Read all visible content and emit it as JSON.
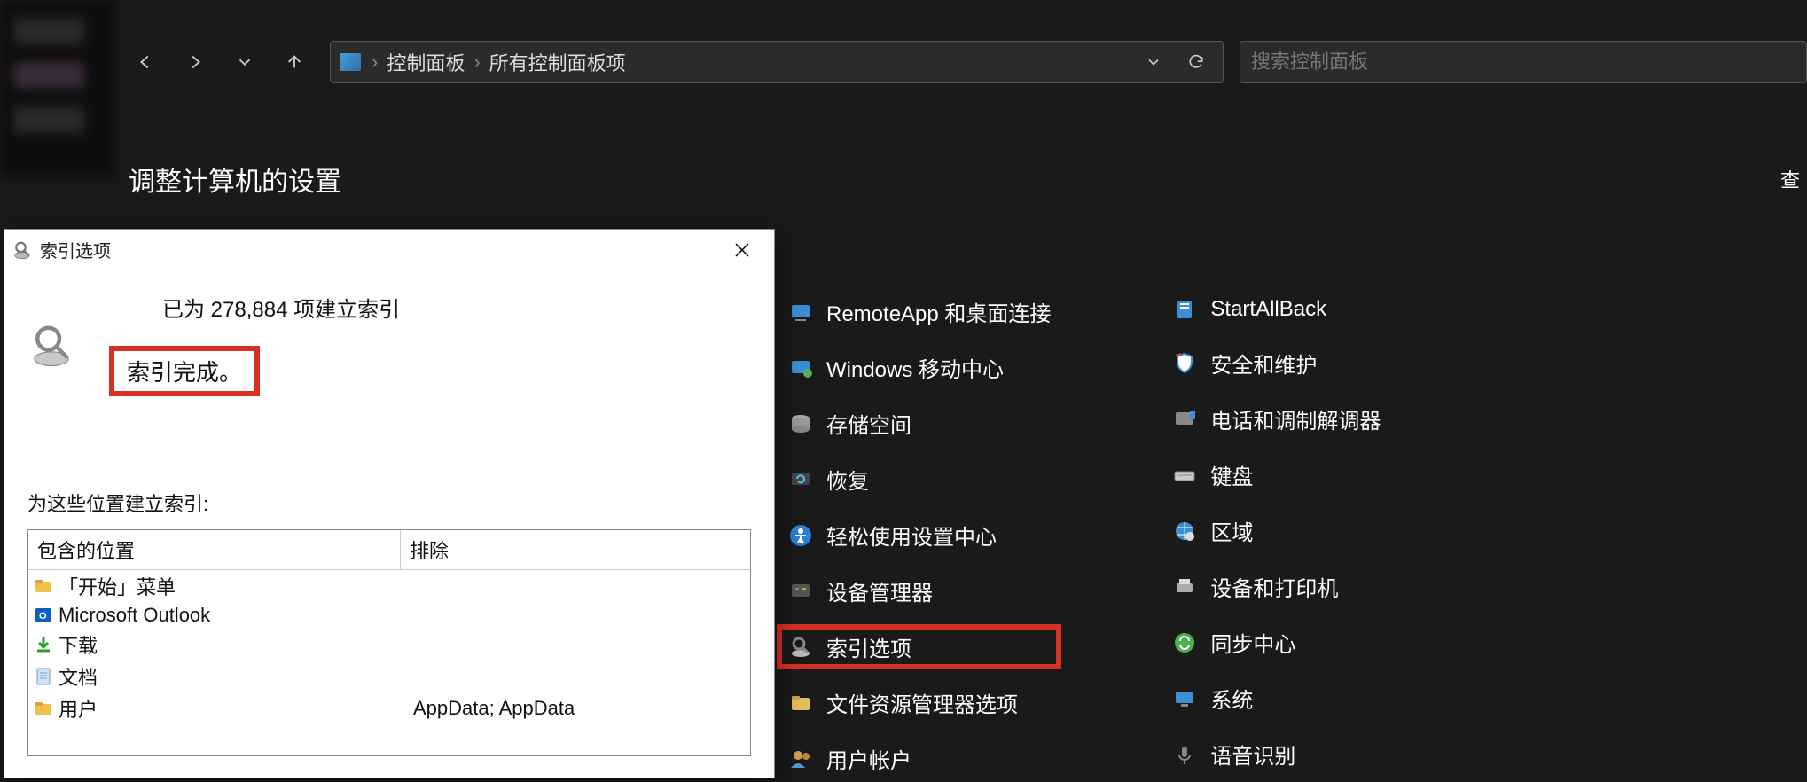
{
  "breadcrumb": {
    "part1": "控制面板",
    "part2": "所有控制面板项"
  },
  "search": {
    "placeholder": "搜索控制面板"
  },
  "header": {
    "title": "调整计算机的设置",
    "view": "查"
  },
  "cp": {
    "col1": [
      {
        "name": "remoteapp",
        "label": "RemoteApp 和桌面连接",
        "highlight": false
      },
      {
        "name": "mobility",
        "label": "Windows 移动中心",
        "highlight": false
      },
      {
        "name": "storage",
        "label": "存储空间",
        "highlight": false
      },
      {
        "name": "recovery",
        "label": "恢复",
        "highlight": false
      },
      {
        "name": "ease",
        "label": "轻松使用设置中心",
        "highlight": false
      },
      {
        "name": "devmgr",
        "label": "设备管理器",
        "highlight": false
      },
      {
        "name": "indexopt",
        "label": "索引选项",
        "highlight": true
      },
      {
        "name": "explorer-opt",
        "label": "文件资源管理器选项",
        "highlight": false
      },
      {
        "name": "useracct",
        "label": "用户帐户",
        "highlight": false
      }
    ],
    "col2": [
      {
        "name": "startallback",
        "label": "StartAllBack"
      },
      {
        "name": "security",
        "label": "安全和维护"
      },
      {
        "name": "phone-modem",
        "label": "电话和调制解调器"
      },
      {
        "name": "keyboard",
        "label": "键盘"
      },
      {
        "name": "region",
        "label": "区域"
      },
      {
        "name": "devices-printers",
        "label": "设备和打印机"
      },
      {
        "name": "sync-center",
        "label": "同步中心"
      },
      {
        "name": "system",
        "label": "系统"
      },
      {
        "name": "speech",
        "label": "语音识别"
      }
    ]
  },
  "dialog": {
    "title": "索引选项",
    "count_line": "已为 278,884 项建立索引",
    "status_line": "索引完成。",
    "locations_label": "为这些位置建立索引:",
    "columns": {
      "included": "包含的位置",
      "excluded": "排除"
    },
    "rows": [
      {
        "icon": "folder",
        "name": "「开始」菜单",
        "excluded": ""
      },
      {
        "icon": "outlook",
        "name": "Microsoft Outlook",
        "excluded": ""
      },
      {
        "icon": "download",
        "name": "下载",
        "excluded": ""
      },
      {
        "icon": "doc",
        "name": "文档",
        "excluded": ""
      },
      {
        "icon": "folder",
        "name": "用户",
        "excluded": "AppData; AppData"
      }
    ]
  }
}
